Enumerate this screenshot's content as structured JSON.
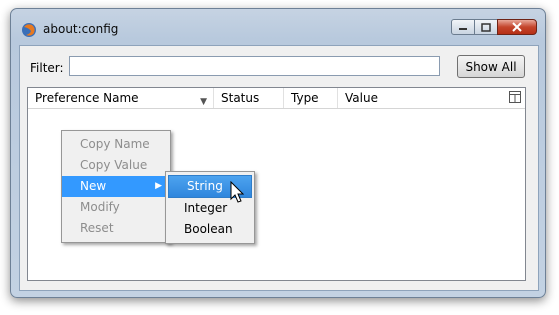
{
  "window": {
    "title": "about:config",
    "controls": [
      "minimize-icon",
      "maximize-icon",
      "close-icon"
    ]
  },
  "filter": {
    "label": "Filter:",
    "value": "",
    "placeholder": ""
  },
  "show_all_button": "Show All",
  "columns": [
    "Preference Name",
    "Status",
    "Type",
    "Value"
  ],
  "context_menu": {
    "items": [
      {
        "label": "Copy Name",
        "enabled": false
      },
      {
        "label": "Copy Value",
        "enabled": false
      },
      {
        "label": "New",
        "enabled": true,
        "highlighted": true,
        "has_submenu": true
      },
      {
        "label": "Modify",
        "enabled": false
      },
      {
        "label": "Reset",
        "enabled": false
      }
    ]
  },
  "submenu": {
    "items": [
      {
        "label": "String",
        "highlighted": true
      },
      {
        "label": "Integer",
        "highlighted": false
      },
      {
        "label": "Boolean",
        "highlighted": false
      }
    ]
  },
  "colors": {
    "menu_highlight": "#3399ff",
    "close_button": "#c4452c",
    "window_frame": "#b8c9dd"
  }
}
